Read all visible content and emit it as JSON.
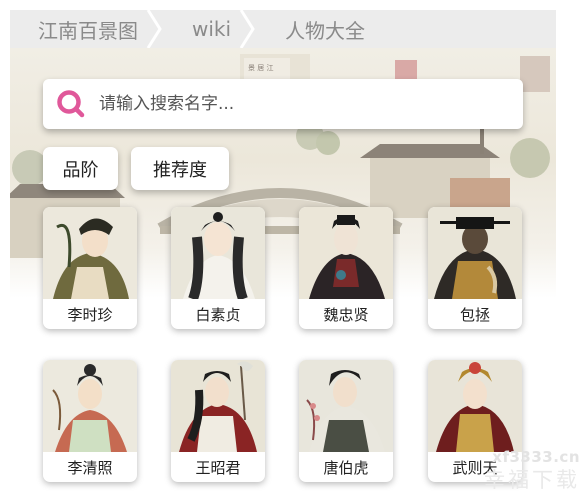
{
  "breadcrumb": [
    "江南百景图",
    "wiki",
    "人物大全"
  ],
  "search": {
    "placeholder": "请输入搜索名字..."
  },
  "filters": [
    "品阶",
    "推荐度"
  ],
  "characters": [
    "李时珍",
    "白素贞",
    "魏忠贤",
    "包拯",
    "李清照",
    "王昭君",
    "唐伯虎",
    "武则天"
  ],
  "watermark": {
    "url": "xf3333.cn",
    "text": "幸福下载"
  },
  "colors": {
    "search_icon": "#e0589a",
    "breadcrumb_bg": "#ececec"
  }
}
